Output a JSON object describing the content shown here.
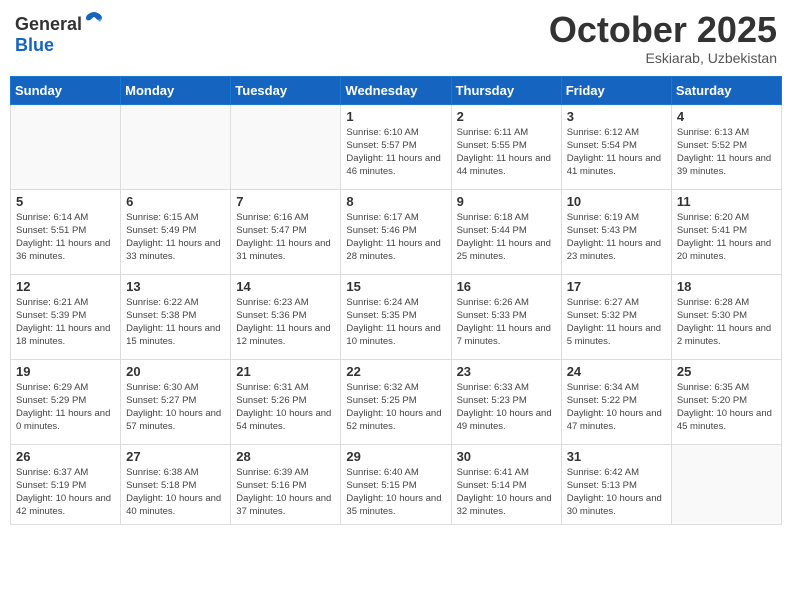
{
  "header": {
    "logo": {
      "general": "General",
      "blue": "Blue"
    },
    "title": "October 2025",
    "location": "Eskiarab, Uzbekistan"
  },
  "weekdays": [
    "Sunday",
    "Monday",
    "Tuesday",
    "Wednesday",
    "Thursday",
    "Friday",
    "Saturday"
  ],
  "weeks": [
    [
      {
        "day": "",
        "info": ""
      },
      {
        "day": "",
        "info": ""
      },
      {
        "day": "",
        "info": ""
      },
      {
        "day": "1",
        "info": "Sunrise: 6:10 AM\nSunset: 5:57 PM\nDaylight: 11 hours and 46 minutes."
      },
      {
        "day": "2",
        "info": "Sunrise: 6:11 AM\nSunset: 5:55 PM\nDaylight: 11 hours and 44 minutes."
      },
      {
        "day": "3",
        "info": "Sunrise: 6:12 AM\nSunset: 5:54 PM\nDaylight: 11 hours and 41 minutes."
      },
      {
        "day": "4",
        "info": "Sunrise: 6:13 AM\nSunset: 5:52 PM\nDaylight: 11 hours and 39 minutes."
      }
    ],
    [
      {
        "day": "5",
        "info": "Sunrise: 6:14 AM\nSunset: 5:51 PM\nDaylight: 11 hours and 36 minutes."
      },
      {
        "day": "6",
        "info": "Sunrise: 6:15 AM\nSunset: 5:49 PM\nDaylight: 11 hours and 33 minutes."
      },
      {
        "day": "7",
        "info": "Sunrise: 6:16 AM\nSunset: 5:47 PM\nDaylight: 11 hours and 31 minutes."
      },
      {
        "day": "8",
        "info": "Sunrise: 6:17 AM\nSunset: 5:46 PM\nDaylight: 11 hours and 28 minutes."
      },
      {
        "day": "9",
        "info": "Sunrise: 6:18 AM\nSunset: 5:44 PM\nDaylight: 11 hours and 25 minutes."
      },
      {
        "day": "10",
        "info": "Sunrise: 6:19 AM\nSunset: 5:43 PM\nDaylight: 11 hours and 23 minutes."
      },
      {
        "day": "11",
        "info": "Sunrise: 6:20 AM\nSunset: 5:41 PM\nDaylight: 11 hours and 20 minutes."
      }
    ],
    [
      {
        "day": "12",
        "info": "Sunrise: 6:21 AM\nSunset: 5:39 PM\nDaylight: 11 hours and 18 minutes."
      },
      {
        "day": "13",
        "info": "Sunrise: 6:22 AM\nSunset: 5:38 PM\nDaylight: 11 hours and 15 minutes."
      },
      {
        "day": "14",
        "info": "Sunrise: 6:23 AM\nSunset: 5:36 PM\nDaylight: 11 hours and 12 minutes."
      },
      {
        "day": "15",
        "info": "Sunrise: 6:24 AM\nSunset: 5:35 PM\nDaylight: 11 hours and 10 minutes."
      },
      {
        "day": "16",
        "info": "Sunrise: 6:26 AM\nSunset: 5:33 PM\nDaylight: 11 hours and 7 minutes."
      },
      {
        "day": "17",
        "info": "Sunrise: 6:27 AM\nSunset: 5:32 PM\nDaylight: 11 hours and 5 minutes."
      },
      {
        "day": "18",
        "info": "Sunrise: 6:28 AM\nSunset: 5:30 PM\nDaylight: 11 hours and 2 minutes."
      }
    ],
    [
      {
        "day": "19",
        "info": "Sunrise: 6:29 AM\nSunset: 5:29 PM\nDaylight: 11 hours and 0 minutes."
      },
      {
        "day": "20",
        "info": "Sunrise: 6:30 AM\nSunset: 5:27 PM\nDaylight: 10 hours and 57 minutes."
      },
      {
        "day": "21",
        "info": "Sunrise: 6:31 AM\nSunset: 5:26 PM\nDaylight: 10 hours and 54 minutes."
      },
      {
        "day": "22",
        "info": "Sunrise: 6:32 AM\nSunset: 5:25 PM\nDaylight: 10 hours and 52 minutes."
      },
      {
        "day": "23",
        "info": "Sunrise: 6:33 AM\nSunset: 5:23 PM\nDaylight: 10 hours and 49 minutes."
      },
      {
        "day": "24",
        "info": "Sunrise: 6:34 AM\nSunset: 5:22 PM\nDaylight: 10 hours and 47 minutes."
      },
      {
        "day": "25",
        "info": "Sunrise: 6:35 AM\nSunset: 5:20 PM\nDaylight: 10 hours and 45 minutes."
      }
    ],
    [
      {
        "day": "26",
        "info": "Sunrise: 6:37 AM\nSunset: 5:19 PM\nDaylight: 10 hours and 42 minutes."
      },
      {
        "day": "27",
        "info": "Sunrise: 6:38 AM\nSunset: 5:18 PM\nDaylight: 10 hours and 40 minutes."
      },
      {
        "day": "28",
        "info": "Sunrise: 6:39 AM\nSunset: 5:16 PM\nDaylight: 10 hours and 37 minutes."
      },
      {
        "day": "29",
        "info": "Sunrise: 6:40 AM\nSunset: 5:15 PM\nDaylight: 10 hours and 35 minutes."
      },
      {
        "day": "30",
        "info": "Sunrise: 6:41 AM\nSunset: 5:14 PM\nDaylight: 10 hours and 32 minutes."
      },
      {
        "day": "31",
        "info": "Sunrise: 6:42 AM\nSunset: 5:13 PM\nDaylight: 10 hours and 30 minutes."
      },
      {
        "day": "",
        "info": ""
      }
    ]
  ]
}
